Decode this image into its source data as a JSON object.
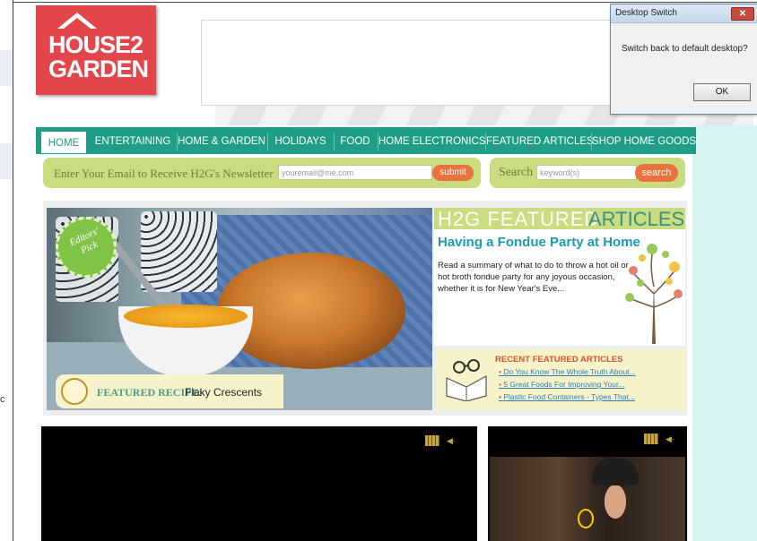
{
  "logo": {
    "line1": "HOUSE2",
    "line2": "GARDEN"
  },
  "dialog": {
    "title": "Desktop Switch",
    "close_glyph": "✕",
    "message": "Switch back to default desktop?",
    "ok_label": "OK"
  },
  "nav": {
    "items": [
      {
        "label": "HOME",
        "active": true
      },
      {
        "label": "ENTERTAINING"
      },
      {
        "label": "HOME & GARDEN"
      },
      {
        "label": "HOLIDAYS"
      },
      {
        "label": "FOOD"
      },
      {
        "label": "HOME ELECTRONICS"
      },
      {
        "label": "FEATURED ARTICLES"
      },
      {
        "label": "SHOP HOME GOODS"
      }
    ]
  },
  "newsletter": {
    "prompt": "Enter Your Email to Receive H2G's Newsletter",
    "placeholder": "youremail@me.com",
    "submit_label": "submit"
  },
  "search": {
    "label": "Search",
    "placeholder": "keyword(s)",
    "button_label": "search"
  },
  "hero": {
    "badge_text": "Editors' Pick",
    "recipe_label": "FEATURED RECIPE:",
    "recipe_name": "Flaky Crescents"
  },
  "featured": {
    "heading_part1": "H2G FEATURED",
    "heading_part2": "ARTICLES",
    "title": "Having a Fondue Party at Home",
    "description": "Read a summary of what to do to throw a hot oil or hot broth fondue party for any joyous occasion, whether it is for New Year's Eve...",
    "recent_heading": "RECENT FEATURED ARTICLES",
    "recent_links": [
      "Do You Know The Whole Truth About...",
      "5 Great Foods For Improving Your...",
      "Plastic Food Containers - Types That..."
    ]
  },
  "left_edge": {
    "char": "c"
  },
  "colors": {
    "nav_bg": "#1f9d87",
    "logo_red": "#e2454a",
    "lime": "#c9dc7f",
    "orange_button": "#e8733f",
    "link_blue": "#1b9bb4"
  }
}
